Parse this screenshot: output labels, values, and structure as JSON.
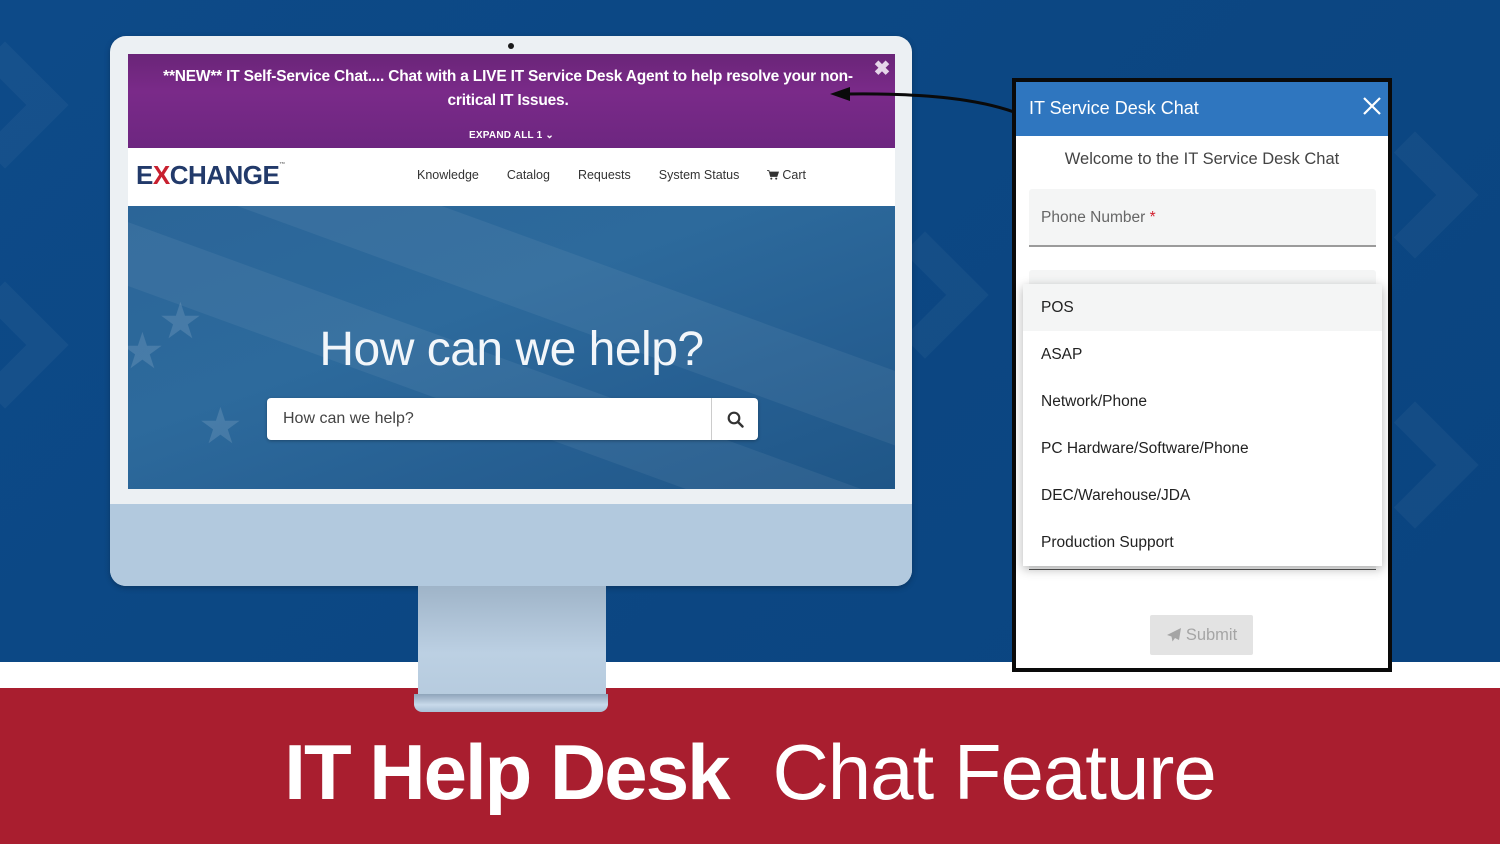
{
  "announcement": {
    "text": "**NEW** IT Self-Service Chat.... Chat with a LIVE IT Service Desk Agent to help resolve your non-critical IT Issues.",
    "expand_label": "EXPAND ALL 1 ⌄",
    "close_icon": "close-icon"
  },
  "site": {
    "logo_prefix": "E",
    "logo_x": "X",
    "logo_suffix": "CHANGE",
    "logo_tm": "™",
    "nav": [
      {
        "label": "Knowledge"
      },
      {
        "label": "Catalog"
      },
      {
        "label": "Requests"
      },
      {
        "label": "System Status"
      },
      {
        "label": "Cart",
        "icon": "cart-icon"
      }
    ],
    "hero_title": "How can we help?",
    "search_placeholder": "How can we help?",
    "search_icon": "search-icon"
  },
  "chat": {
    "title": "IT Service Desk Chat",
    "welcome": "Welcome to the IT Service Desk Chat",
    "phone_label": "Phone Number",
    "required_mark": "*",
    "category_options": [
      {
        "label": "POS",
        "highlighted": true
      },
      {
        "label": "ASAP"
      },
      {
        "label": "Network/Phone"
      },
      {
        "label": "PC Hardware/Software/Phone"
      },
      {
        "label": "DEC/Warehouse/JDA"
      },
      {
        "label": "Production Support"
      }
    ],
    "submit_label": "Submit",
    "submit_icon": "paper-plane-icon"
  },
  "footer": {
    "title_bold": "IT Help Desk",
    "title_light": "Chat Feature"
  },
  "colors": {
    "background_blue": "#0c4783",
    "banner_red": "#a91e2f",
    "announcement_purple": "#7a2a89",
    "chat_header_blue": "#2f76bf",
    "logo_navy": "#223a6a",
    "logo_red": "#c8202f"
  }
}
